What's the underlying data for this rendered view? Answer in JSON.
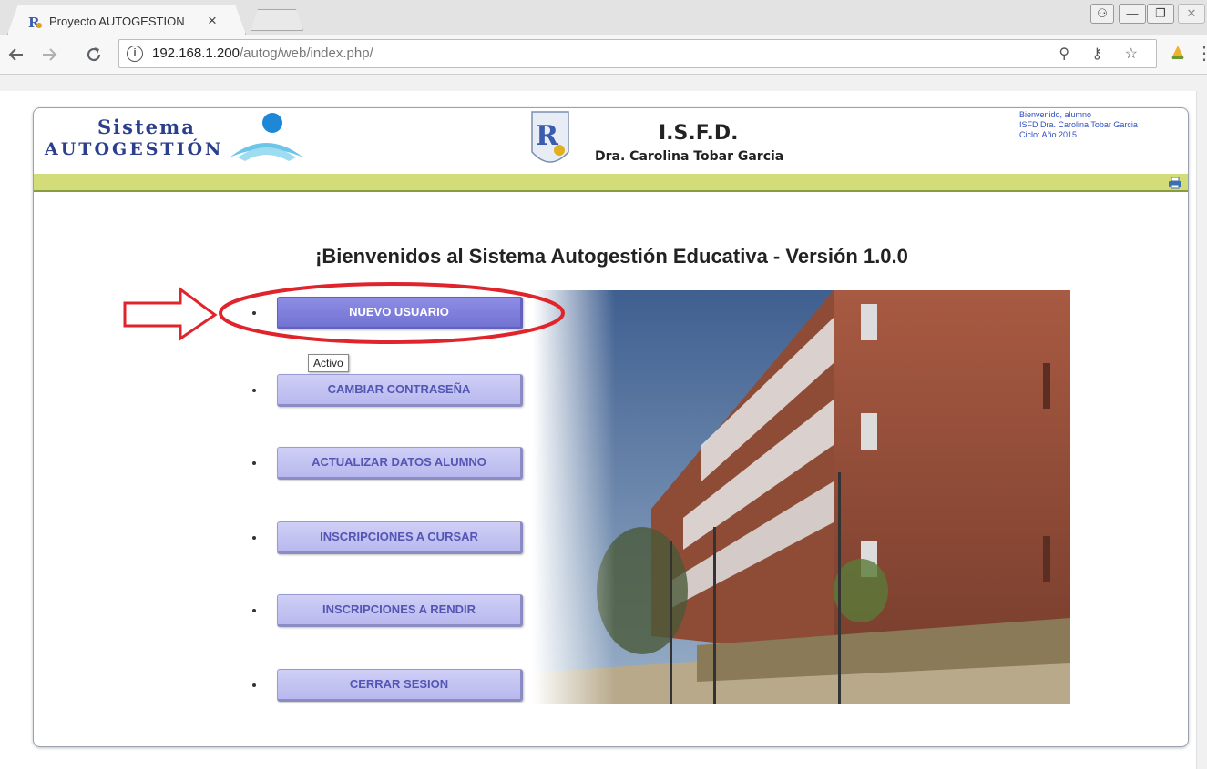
{
  "browser": {
    "tab_title": "Proyecto AUTOGESTION",
    "tab_close": "×",
    "url_host": "192.168.1.200",
    "url_path": "/autog/web/index.php/",
    "info_glyph": "i",
    "omnibox_icons": "⚲ ⚷ ☆",
    "menu_glyph": "⋮",
    "window_controls": [
      "⚇",
      "—",
      "❐",
      "✕"
    ],
    "icons": [
      "back-icon",
      "forward-icon",
      "reload-icon",
      "info-icon",
      "zoom-icon",
      "key-icon",
      "star-icon",
      "extension-icon",
      "menu-icon"
    ]
  },
  "header": {
    "logo_line1": "Sistema",
    "logo_line2": "AUTOGESTIÓN",
    "institution_title": "I.S.F.D.",
    "institution_name": "Dra. Carolina Tobar Garcia",
    "user_greeting": "Bienvenido, alumno",
    "user_institution": "ISFD Dra. Carolina Tobar Garcia",
    "user_cycle": "Ciclo: Año 2015"
  },
  "main": {
    "welcome": "¡Bienvenidos al Sistema Autogestión Educativa - Versión 1.0.0",
    "menu": [
      {
        "label": "NUEVO USUARIO",
        "active": true
      },
      {
        "label": "CAMBIAR CONTRASEÑA",
        "active": false
      },
      {
        "label": "ACTUALIZAR DATOS ALUMNO",
        "active": false
      },
      {
        "label": "INSCRIPCIONES A CURSAR",
        "active": false
      },
      {
        "label": "INSCRIPCIONES A RENDIR",
        "active": false
      },
      {
        "label": "CERRAR SESION",
        "active": false
      }
    ],
    "tooltip": "Activo"
  },
  "colors": {
    "accent_band": "#d2dc78",
    "button_bg": "#c4c4f2",
    "button_active": "#7e7edc",
    "button_text": "#5455b4",
    "annotation": "#e0242b"
  }
}
